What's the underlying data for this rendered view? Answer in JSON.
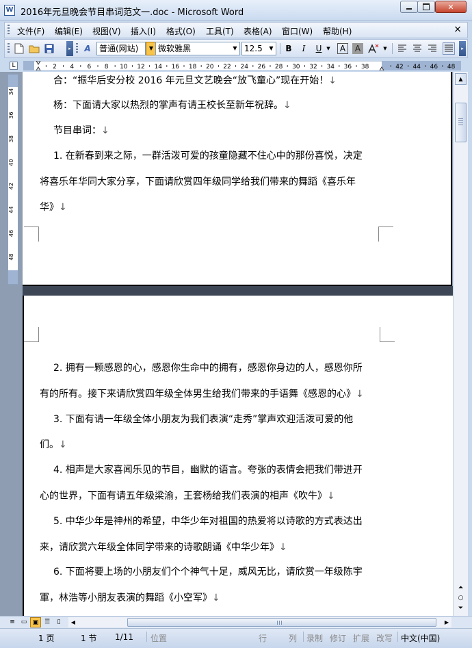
{
  "window": {
    "title": "2016年元旦晚会节目串词范文一.doc - Microsoft Word",
    "app_icon": "W",
    "controls": {
      "minimize_icon": "minimize-icon",
      "maximize_icon": "maximize-icon",
      "close_icon": "close-icon"
    }
  },
  "menubar": {
    "items": [
      "文件(F)",
      "编辑(E)",
      "视图(V)",
      "插入(I)",
      "格式(O)",
      "工具(T)",
      "表格(A)",
      "窗口(W)",
      "帮助(H)"
    ],
    "close_glyph": "×"
  },
  "toolbar": {
    "style_value": "普通(网站)",
    "font_value": "微软雅黑",
    "size_value": "12.5",
    "bold": "B",
    "italic": "I",
    "underline": "U",
    "font_color_a": "A",
    "highlight_a": "A",
    "styles_icon": "A"
  },
  "ruler": {
    "tab_selector": "L",
    "h_labels": [
      "2",
      "4",
      "6",
      "8",
      "10",
      "12",
      "14",
      "16",
      "18",
      "20",
      "22",
      "24",
      "26",
      "28",
      "30",
      "32",
      "34",
      "36",
      "38",
      "42",
      "44",
      "46",
      "48"
    ],
    "v_labels": [
      "34",
      "36",
      "38",
      "40",
      "42",
      "44",
      "46",
      "48"
    ]
  },
  "document": {
    "page1_paragraphs": [
      "合：“振华后安分校 2016 年元旦文艺晚会“放飞童心”现在开始！",
      "杨：下面请大家以热烈的掌声有请王校长至新年祝辞。",
      "节目串词：",
      "1. 在新春到来之际，一群活泼可爱的孩童隐藏不住心中的那份喜悦，决定",
      "将喜乐年华同大家分享，下面请欣赏四年级同学给我们带来的舞蹈《喜乐年",
      "华》"
    ],
    "page2_paragraphs": [
      "2. 拥有一颗感恩的心，感恩你生命中的拥有，感恩你身边的人，感恩你所",
      "有的所有。接下来请欣赏四年级全体男生给我们带来的手语舞《感恩的心》",
      "3. 下面有请一年级全体小朋友为我们表演“走秀”掌声欢迎活泼可爱的他",
      "们。",
      "4. 相声是大家喜闻乐见的节目，幽默的语言。夸张的表情会把我们带进开",
      "心的世界，下面有请五年级梁渝，王套杨给我们表演的相声《吹牛》",
      "5. 中华少年是神州的希望，中华少年对祖国的热爱将以诗歌的方式表达出",
      "来，请欣赏六年级全体同学带来的诗歌朗诵《中华少年》",
      "6. 下面将要上场的小朋友们个个神气十足，威风无比，请欣赏一年级陈宇",
      "軍，林浩等小朋友表演的舞蹈《小空军》"
    ],
    "para_mark": "↓"
  },
  "statusbar": {
    "page": "1 页",
    "section": "1 节",
    "page_of": "1/11",
    "position": "位置",
    "line": "行",
    "column": "列",
    "rec": "录制",
    "trk": "修订",
    "ext": "扩展",
    "ovr": "改写",
    "language": "中文(中国)"
  },
  "colors": {
    "chrome": "#c9d9ee",
    "doc_background": "#8e9db2",
    "page_gap": "#3c4654",
    "active_button": "#f9c44a"
  }
}
